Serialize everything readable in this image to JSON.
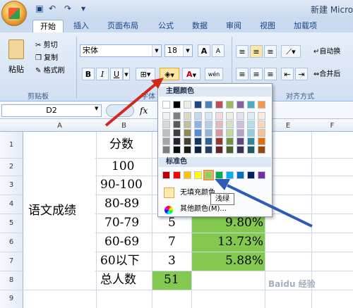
{
  "window": {
    "title": "新建 Micro"
  },
  "tabs": [
    "开始",
    "插入",
    "页面布局",
    "公式",
    "数据",
    "审阅",
    "视图",
    "加载项"
  ],
  "ribbon": {
    "clipboard": {
      "paste": "粘贴",
      "cut": "剪切",
      "copy": "复制",
      "format_painter": "格式刷",
      "label": "剪贴板"
    },
    "font": {
      "name": "宋体",
      "size": "18",
      "bold": "B",
      "italic": "I",
      "underline": "U",
      "label": "字体",
      "grow": "A",
      "shrink": "A",
      "wen": "wén"
    },
    "alignment": {
      "label": "对齐方式",
      "wrap": "自动换",
      "merge": "合并后"
    }
  },
  "formula_bar": {
    "name_box": "D2",
    "fx": "fx"
  },
  "columns": [
    "A",
    "B",
    "C",
    "D",
    "E",
    "F"
  ],
  "rows": [
    "1",
    "2",
    "3",
    "4",
    "5",
    "6",
    "7",
    "8",
    "9"
  ],
  "cells": {
    "a_merged": "语文成绩",
    "b": [
      "分数",
      "100",
      "90-100",
      "80-89",
      "70-79",
      "60-69",
      "60以下",
      "总人数"
    ],
    "c": [
      "5",
      "7",
      "3",
      "51"
    ],
    "d": [
      "9.80%",
      "13.73%",
      "5.88%"
    ]
  },
  "palette": {
    "theme_title": "主题颜色",
    "standard_title": "标准色",
    "no_fill": "无填充颜色",
    "more_colors": "其他颜色(M)...",
    "tooltip": "浅绿",
    "theme_top": [
      "#ffffff",
      "#000000",
      "#eeece1",
      "#1f497d",
      "#4f81bd",
      "#c0504d",
      "#9bbb59",
      "#8064a2",
      "#4bacc6",
      "#f79646"
    ],
    "theme_shades": [
      [
        "#f2f2f2",
        "#7f7f7f",
        "#ddd9c3",
        "#c6d9f0",
        "#dbe5f1",
        "#f2dcdb",
        "#ebf1dd",
        "#e5e0ec",
        "#dbeef3",
        "#fdeada"
      ],
      [
        "#d8d8d8",
        "#595959",
        "#c4bd97",
        "#8db3e2",
        "#b8cce4",
        "#e5b9b7",
        "#d7e3bc",
        "#ccc1d9",
        "#b7dde8",
        "#fbd5b5"
      ],
      [
        "#bfbfbf",
        "#3f3f3f",
        "#938953",
        "#548dd4",
        "#95b3d7",
        "#d99694",
        "#c3d69b",
        "#b2a2c7",
        "#92cddc",
        "#fac08f"
      ],
      [
        "#a5a5a5",
        "#262626",
        "#494429",
        "#17365d",
        "#366092",
        "#953734",
        "#76923c",
        "#5f497a",
        "#31859b",
        "#e36c09"
      ],
      [
        "#7f7f7f",
        "#0c0c0c",
        "#1d1b10",
        "#0f243e",
        "#244061",
        "#632423",
        "#4f6128",
        "#3f3151",
        "#205867",
        "#974806"
      ]
    ],
    "standard": [
      "#c00000",
      "#ff0000",
      "#ffc000",
      "#ffff00",
      "#92d050",
      "#00b050",
      "#00b0f0",
      "#0070c0",
      "#002060",
      "#7030a0"
    ]
  },
  "watermark": "Baidu 经验"
}
